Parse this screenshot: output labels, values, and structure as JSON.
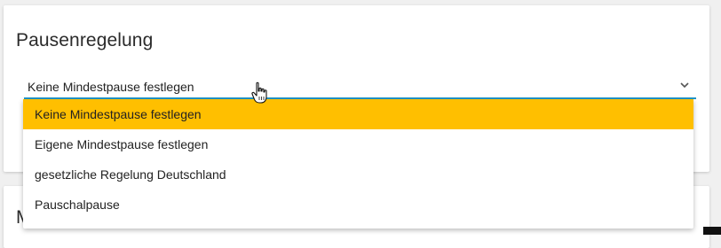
{
  "section": {
    "title": "Pausenregelung",
    "next_title_partial": "M"
  },
  "select": {
    "value": "Keine Mindestpause festlegen",
    "icon": "chevron-down-icon",
    "accent_color": "#2196c8"
  },
  "dropdown": {
    "selected_color": "#ffbf00",
    "options": [
      {
        "label": "Keine Mindestpause festlegen",
        "selected": true
      },
      {
        "label": "Eigene Mindestpause festlegen",
        "selected": false
      },
      {
        "label": "gesetzliche Regelung Deutschland",
        "selected": false
      },
      {
        "label": "Pauschalpause",
        "selected": false
      }
    ]
  },
  "cursor": {
    "icon": "hand-pointer-cursor-icon"
  }
}
